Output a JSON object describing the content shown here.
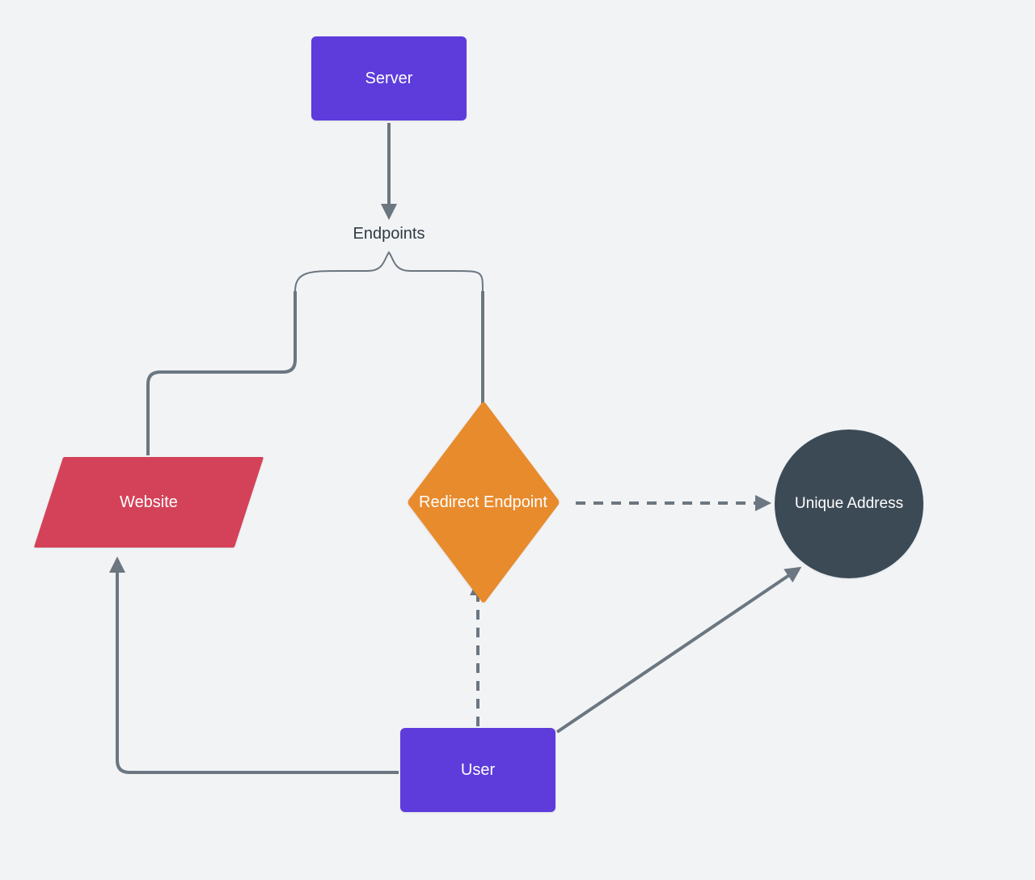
{
  "nodes": {
    "server": {
      "label": "Server",
      "shape": "rectangle",
      "color": "#5d3cdb"
    },
    "website": {
      "label": "Website",
      "shape": "parallelogram",
      "color": "#d44259"
    },
    "redirect": {
      "label": "Redirect Endpoint",
      "shape": "diamond",
      "color": "#e88b2d"
    },
    "unique": {
      "label": "Unique Address",
      "shape": "circle",
      "color": "#3c4a56"
    },
    "user": {
      "label": "User",
      "shape": "rectangle",
      "color": "#5d3cdb"
    }
  },
  "edges": {
    "server_to_endpoints": {
      "from": "server",
      "to": "endpoints-brace",
      "style": "solid",
      "arrow": true,
      "label": "Endpoints"
    },
    "endpoints_to_website": {
      "from": "endpoints-brace",
      "to": "website",
      "style": "solid",
      "arrow": false
    },
    "endpoints_to_redirect": {
      "from": "endpoints-brace",
      "to": "redirect",
      "style": "solid",
      "arrow": false
    },
    "redirect_to_unique": {
      "from": "redirect",
      "to": "unique",
      "style": "dashed",
      "arrow": true
    },
    "user_to_website": {
      "from": "user",
      "to": "website",
      "style": "solid",
      "arrow": true
    },
    "user_to_redirect": {
      "from": "user",
      "to": "redirect",
      "style": "dashed",
      "arrow": true
    },
    "user_to_unique": {
      "from": "user",
      "to": "unique",
      "style": "solid",
      "arrow": true
    }
  },
  "labels": {
    "endpoints": "Endpoints"
  },
  "colors": {
    "edge": "#6b7680",
    "background": "#f1f3f5"
  }
}
